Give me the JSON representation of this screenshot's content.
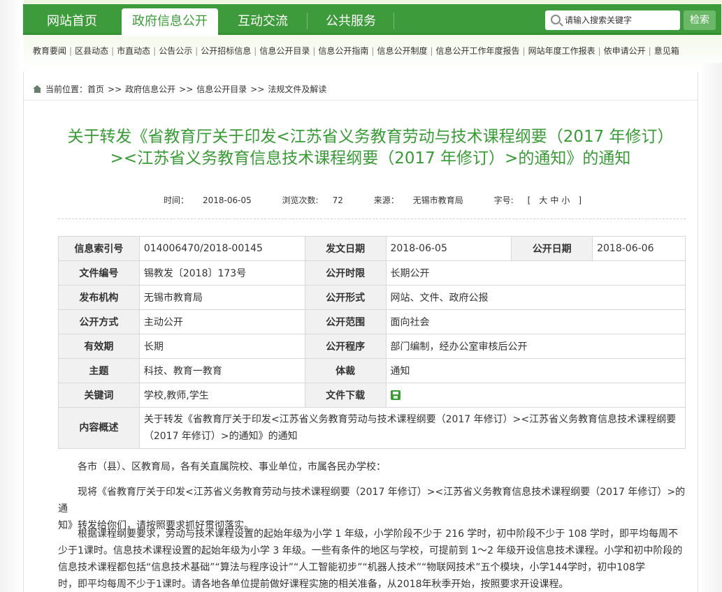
{
  "nav": {
    "tabs": [
      "网站首页",
      "政府信息公开",
      "互动交流",
      "公共服务"
    ],
    "active_index": 1,
    "search_placeholder": "请输入搜索关键字",
    "search_button": "检索"
  },
  "subnav": {
    "items": [
      "教育要闻",
      "区县动态",
      "市直动态",
      "公告公示",
      "公开招标信息",
      "信息公开目录",
      "信息公开指南",
      "信息公开制度",
      "信息公开工作年度报告",
      "网站年度工作报表",
      "依申请公开",
      "意见箱"
    ]
  },
  "breadcrumb": {
    "prefix": "当前位置：",
    "items": [
      "首页",
      "政府信息公开",
      "信息公开目录",
      "法规文件及解读"
    ],
    "separator": ">>"
  },
  "article": {
    "title_line1": "关于转发《省教育厅关于印发<江苏省义务教育劳动与技术课程纲要（2017 年修订）",
    "title_line2": "><江苏省义务教育信息技术课程纲要（2017 年修订）>的通知》的通知",
    "meta": {
      "time_label": "时间：",
      "time": "2018-06-05",
      "views_label": "浏览次数:",
      "views": "72",
      "source_label": "来源：",
      "source": "无锡市教育局",
      "font_label": "字号:",
      "font_open": "[",
      "font_large": "大",
      "font_medium": "中",
      "font_small": "小",
      "font_close": "]"
    }
  },
  "info_table": {
    "index_no_label": "信息索引号",
    "index_no": "014006470/2018-00145",
    "issue_date_label": "发文日期",
    "issue_date": "2018-06-05",
    "publish_date_label": "公开日期",
    "publish_date": "2018-06-06",
    "doc_no_label": "文件编号",
    "doc_no": "锡教发〔2018〕173号",
    "period_label": "公开时限",
    "period": "长期公开",
    "org_label": "发布机构",
    "org": "无锡市教育局",
    "form_label": "公开形式",
    "form": "网站、文件、政府公报",
    "method_label": "公开方式",
    "method": "主动公开",
    "scope_label": "公开范围",
    "scope": "面向社会",
    "validity_label": "有效期",
    "validity": "长期",
    "procedure_label": "公开程序",
    "procedure": "部门编制，经办公室审核后公开",
    "topic_label": "主题",
    "topic": "科技、教育一教育",
    "genre_label": "体裁",
    "genre": "通知",
    "keywords_label": "关键词",
    "keywords": "学校,教师,学生",
    "download_label": "文件下载",
    "download_icon": "save-icon",
    "summary_label": "内容概述",
    "summary_line1": "关于转发《省教育厅关于印发<江苏省义务教育劳动与技术课程纲要（2017 年修订）><江苏省义务教育信息技术课程纲要",
    "summary_line2": "（2017 年修订）>的通知》的通知"
  },
  "body": {
    "p1": "各市（县）、区教育局，各有关直属院校、事业单位，市属各民办学校：",
    "p2_line1": "现将《省教育厅关于印发<江苏省义务教育劳动与技术课程纲要（2017 年修订）><江苏省义务教育信息技术课程纲要（2017 年修订）>的通",
    "p2_line2": "知》转发给你们，请按照要求抓好贯彻落实。",
    "p3_line1": "根据课程纲要要求，劳动与技术课程设置的起始年级为小学 1 年级，小学阶段不少于 216 学时，初中阶段不少于 108 学时，即平均每周不",
    "p3_line2": "少于1课时。信息技术课程设置的起始年级为小学 3 年级。一些有条件的地区与学校，可提前到 1～2 年级开设信息技术课程。小学和初中阶段的",
    "p3_line3": "信息技术课程都包括“信息技术基础”“算法与程序设计”“人工智能初步”“机器人技术”“物联网技术”五个模块，小学144学时，初中108学",
    "p3_line4": "时，即平均每周不少于1课时。请各地各单位提前做好课程实施的相关准备，从2018年秋季开始，按照要求开设课程。"
  }
}
